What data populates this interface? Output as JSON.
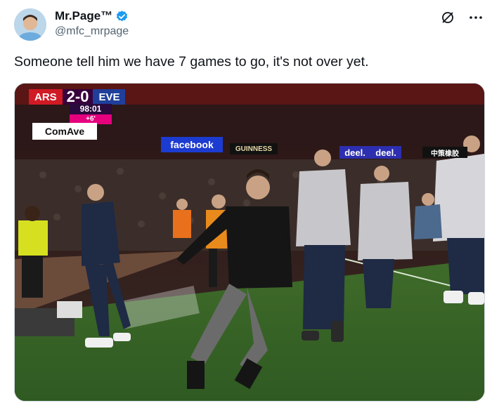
{
  "post": {
    "author_name": "Mr.Page™",
    "author_handle": "@mfc_mrpage",
    "text": "Someone tell him we have 7 games to go, it's not over yet."
  },
  "icons": {
    "avatar": "avatar",
    "verified": "verified-badge-icon",
    "grok": "grok-icon",
    "more": "more-options-icon"
  },
  "media": {
    "scoreboard": {
      "home": "ARS",
      "score": "2-0",
      "away": "EVE",
      "clock": "98:01",
      "added_time": "+6'"
    },
    "boards": {
      "comave": "ComAve",
      "facebook": "facebook",
      "guinness": "GUINNESS",
      "deel1": "deel.",
      "deel2": "deel.",
      "chinese": "中策橡胶"
    }
  },
  "colors": {
    "arsenal_red": "#d01a24",
    "everton_blue": "#1f3f9a",
    "pl_purple": "#38003c",
    "verified_blue": "#1d9bf0"
  }
}
